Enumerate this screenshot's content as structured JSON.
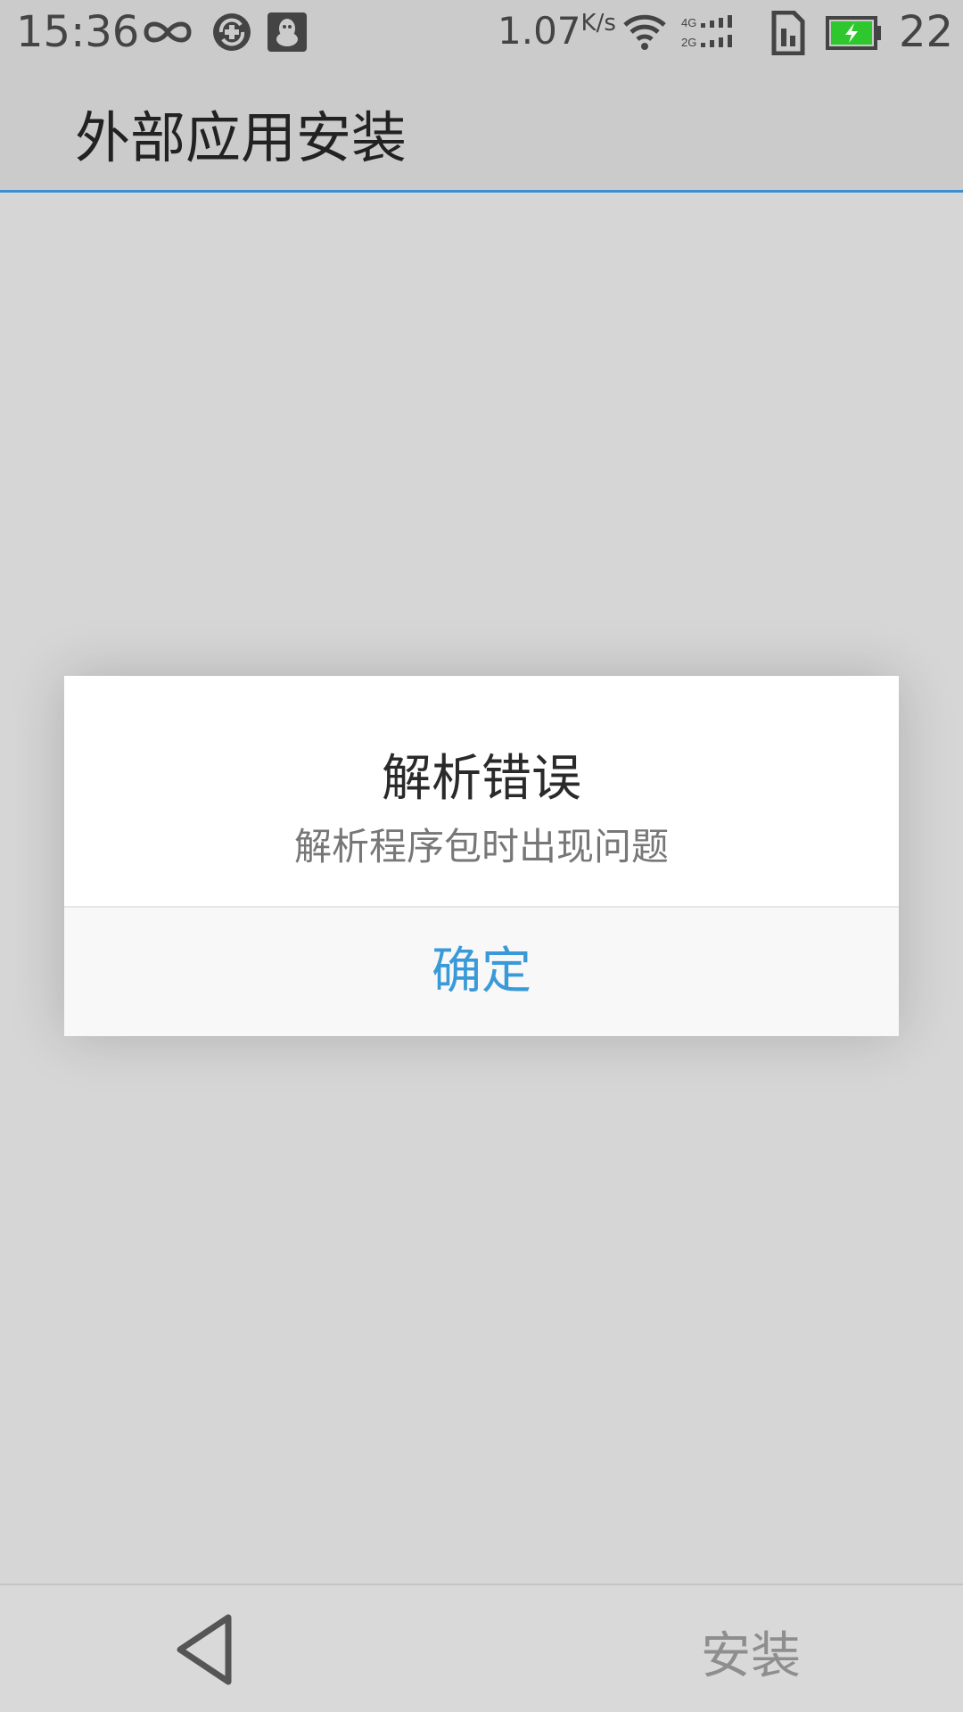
{
  "status_bar": {
    "time": "15:36",
    "net_speed_value": "1.07",
    "net_speed_unit": "K/s",
    "battery_level": "22",
    "icons": [
      "infinity-icon",
      "sync-app-icon",
      "qq-icon",
      "wifi-icon",
      "cellular-4g-2g-icon",
      "sim-icon",
      "battery-charging-icon"
    ],
    "battery_color": "#2ec82e"
  },
  "app_bar": {
    "title": "外部应用安装",
    "accent_color": "#3b8ed3"
  },
  "dialog": {
    "title": "解析错误",
    "message": "解析程序包时出现问题",
    "confirm_label": "确定",
    "confirm_color": "#3a9ad8"
  },
  "bottom_bar": {
    "back_icon": "back-triangle-icon",
    "install_label": "安装"
  }
}
